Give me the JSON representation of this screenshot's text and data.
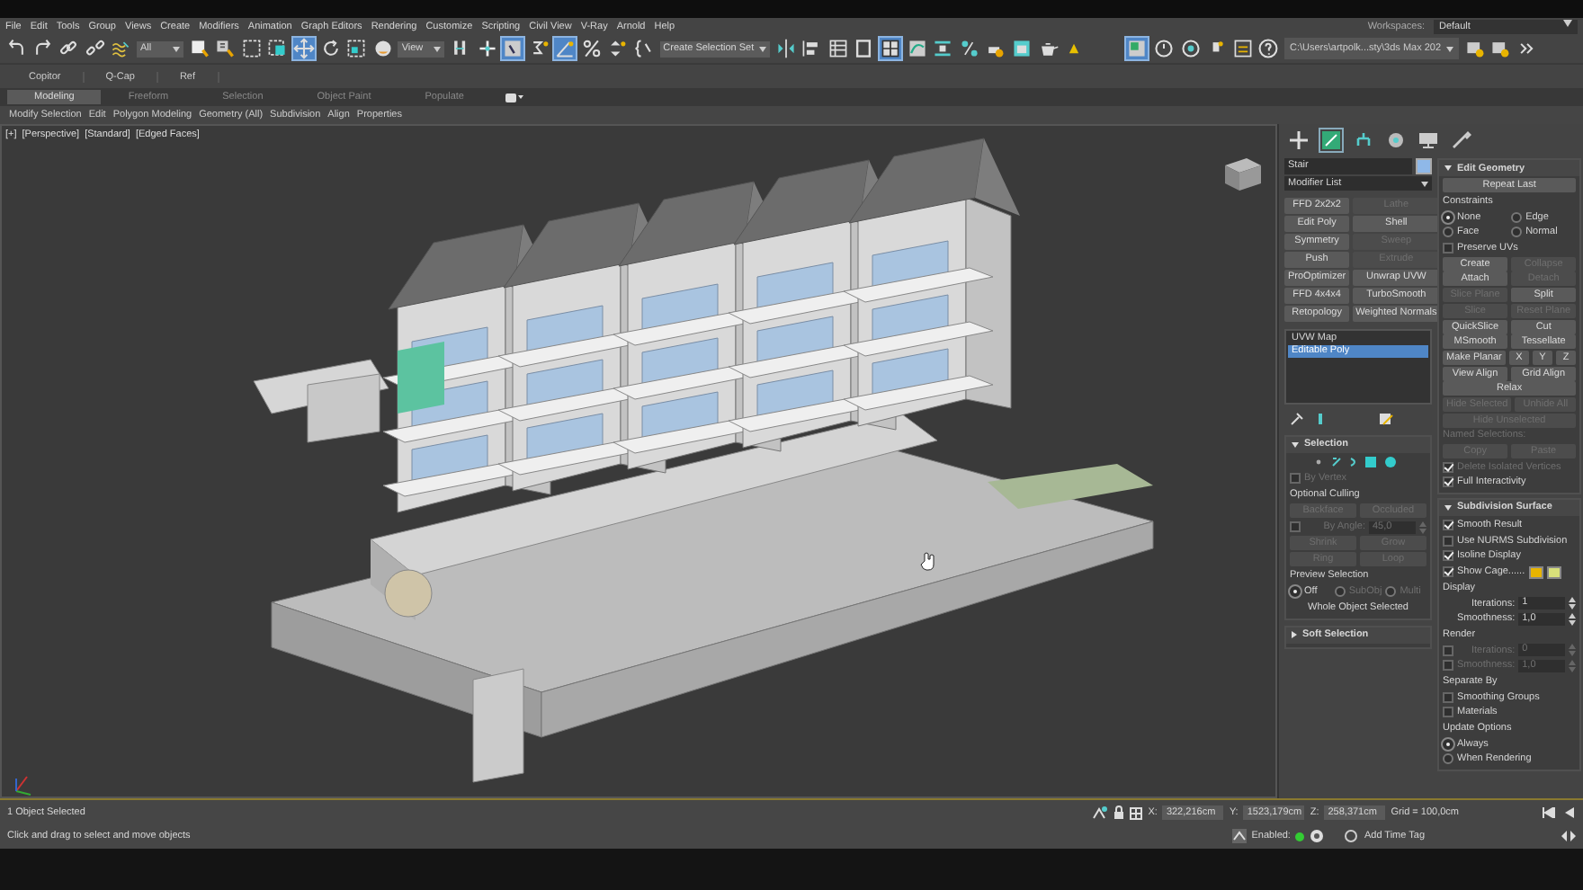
{
  "menu_bar": {
    "items": [
      "File",
      "Edit",
      "Tools",
      "Group",
      "Views",
      "Create",
      "Modifiers",
      "Animation",
      "Graph Editors",
      "Rendering",
      "Customize",
      "Scripting",
      "Civil View",
      "V-Ray",
      "Arnold",
      "Help"
    ],
    "workspaces_label": "Workspaces:",
    "workspace": "Default"
  },
  "toolbar": {
    "tools": [
      {
        "kind": "undo",
        "active": false
      },
      {
        "kind": "redo",
        "active": false
      },
      {
        "kind": "link",
        "active": false
      },
      {
        "kind": "unlink",
        "active": false
      },
      {
        "kind": "bind",
        "active": false
      },
      {
        "kind": "dropdown",
        "label": "All",
        "active": false
      },
      {
        "kind": "select",
        "active": false
      },
      {
        "kind": "select_name",
        "active": false
      },
      {
        "kind": "region",
        "active": false
      },
      {
        "kind": "crossing",
        "active": false
      },
      {
        "kind": "move",
        "active": true
      },
      {
        "kind": "rotate",
        "active": false
      },
      {
        "kind": "scale",
        "active": false
      },
      {
        "kind": "place",
        "active": false
      },
      {
        "kind": "dropdown",
        "label": "View",
        "active": false
      },
      {
        "kind": "pivot",
        "active": false
      },
      {
        "kind": "manipulate",
        "active": false
      },
      {
        "kind": "keyboard",
        "active": true
      },
      {
        "kind": "snap",
        "active": false
      },
      {
        "kind": "angle_snap",
        "active": true
      },
      {
        "kind": "percent_snap",
        "active": false
      },
      {
        "kind": "spinner_snap",
        "active": false
      },
      {
        "kind": "named_sel",
        "active": false
      },
      {
        "kind": "dropdown",
        "label": "Create Selection Set",
        "active": false
      },
      {
        "kind": "mirror",
        "active": false
      },
      {
        "kind": "align",
        "active": false
      },
      {
        "kind": "layer",
        "active": false
      },
      {
        "kind": "panel",
        "active": false
      },
      {
        "kind": "ribbon",
        "active": true
      },
      {
        "kind": "curve",
        "active": false
      },
      {
        "kind": "schematic",
        "active": false
      },
      {
        "kind": "material",
        "active": false
      },
      {
        "kind": "render_setup",
        "active": false
      },
      {
        "kind": "render_frame",
        "active": false
      },
      {
        "kind": "render",
        "active": false
      },
      {
        "kind": "warning",
        "active": false
      },
      {
        "kind": "gap"
      },
      {
        "kind": "layout",
        "active": true
      },
      {
        "kind": "clock",
        "active": false
      },
      {
        "kind": "dial",
        "active": false
      },
      {
        "kind": "bulb",
        "active": false
      },
      {
        "kind": "window",
        "active": false
      },
      {
        "kind": "help",
        "active": false
      },
      {
        "kind": "path",
        "label": "C:\\Users\\artpolk...sty\\3ds Max 202",
        "active": false
      },
      {
        "kind": "project",
        "active": false
      },
      {
        "kind": "project",
        "active": false
      },
      {
        "kind": "more",
        "active": false
      }
    ]
  },
  "ribbon": {
    "quick": [
      "Copitor",
      "Q-Cap",
      "Ref"
    ],
    "tabs": [
      {
        "label": "Modeling",
        "selected": true
      },
      {
        "label": "Freeform",
        "selected": false
      },
      {
        "label": "Selection",
        "selected": false
      },
      {
        "label": "Object Paint",
        "selected": false
      },
      {
        "label": "Populate",
        "selected": false
      }
    ],
    "panels": [
      "Modify Selection",
      "Edit",
      "Polygon Modeling",
      "Geometry (All)",
      "Subdivision",
      "Align",
      "Properties"
    ]
  },
  "viewport": {
    "labels": [
      "[+]",
      "[Perspective]",
      "[Standard]",
      "[Edged Faces]"
    ]
  },
  "command_panel": {
    "tabs": [
      {
        "kind": "create",
        "selected": false
      },
      {
        "kind": "modify",
        "selected": true
      },
      {
        "kind": "hierarchy",
        "selected": false
      },
      {
        "kind": "motion",
        "selected": false
      },
      {
        "kind": "display",
        "selected": false
      },
      {
        "kind": "utilities",
        "selected": false
      }
    ],
    "object_name": "Stair",
    "modifier_list": "Modifier List",
    "modifier_buttons": [
      {
        "label": "FFD 2x2x2",
        "disabled": false
      },
      {
        "label": "Lathe",
        "disabled": true
      },
      {
        "label": "Edit Poly",
        "disabled": false
      },
      {
        "label": "Shell",
        "disabled": false
      },
      {
        "label": "Symmetry",
        "disabled": false
      },
      {
        "label": "Sweep",
        "disabled": true
      },
      {
        "label": "Push",
        "disabled": false
      },
      {
        "label": "Extrude",
        "disabled": true
      },
      {
        "label": "ProOptimizer",
        "disabled": false
      },
      {
        "label": "Unwrap UVW",
        "disabled": false
      },
      {
        "label": "FFD 4x4x4",
        "disabled": false
      },
      {
        "label": "TurboSmooth",
        "disabled": false
      },
      {
        "label": "Retopology",
        "disabled": false
      },
      {
        "label": "Weighted Normals",
        "disabled": false
      }
    ],
    "stack": [
      {
        "label": "UVW Map",
        "selected": false
      },
      {
        "label": "Editable Poly",
        "selected": true
      }
    ],
    "left_rollouts": [
      {
        "title": "Selection",
        "expanded": true,
        "rows": [
          [
            {
              "kind": "icons"
            }
          ],
          [
            {
              "kind": "checkbox",
              "label": "By Vertex",
              "checked": false,
              "disabled": true
            }
          ],
          [
            {
              "kind": "label",
              "label": "Optional Culling",
              "disabled": false
            }
          ],
          [
            {
              "kind": "button",
              "label": "Backface",
              "disabled": true
            },
            {
              "kind": "button",
              "label": "Occluded",
              "disabled": true
            }
          ],
          [
            {
              "kind": "check_spinner",
              "label": "By Angle:",
              "value": "45,0",
              "checked": false,
              "disabled": true
            }
          ],
          [
            {
              "kind": "button",
              "label": "Shrink",
              "disabled": true
            },
            {
              "kind": "button",
              "label": "Grow",
              "disabled": true
            }
          ],
          [
            {
              "kind": "button",
              "label": "Ring",
              "disabled": true
            },
            {
              "kind": "button",
              "label": "Loop",
              "disabled": true
            }
          ],
          [
            {
              "kind": "label",
              "label": "Preview Selection",
              "disabled": false
            }
          ],
          [
            {
              "kind": "radio",
              "label": "Off",
              "selected": true,
              "disabled": false
            },
            {
              "kind": "radio",
              "label": "SubObj",
              "selected": false,
              "disabled": true
            },
            {
              "kind": "radio",
              "label": "Multi",
              "selected": false,
              "disabled": true
            }
          ],
          [
            {
              "kind": "note",
              "label": "Whole Object Selected",
              "disabled": false
            }
          ]
        ]
      },
      {
        "title": "Soft Selection",
        "expanded": false
      }
    ],
    "right_rollouts": [
      {
        "title": "Edit Geometry",
        "expanded": true,
        "rows": [
          [
            {
              "kind": "button",
              "label": "Repeat Last",
              "disabled": false
            }
          ],
          [
            {
              "kind": "label",
              "label": "Constraints",
              "disabled": false
            }
          ],
          [
            {
              "kind": "radio",
              "label": "None",
              "selected": true,
              "disabled": false
            },
            {
              "kind": "radio",
              "label": "Edge",
              "selected": false,
              "disabled": false
            }
          ],
          [
            {
              "kind": "radio",
              "label": "Face",
              "selected": false,
              "disabled": false
            },
            {
              "kind": "radio",
              "label": "Normal",
              "selected": false,
              "disabled": false
            }
          ],
          [
            {
              "kind": "checkbox",
              "label": "Preserve UVs",
              "checked": false,
              "disabled": false
            }
          ],
          [
            {
              "kind": "button",
              "label": "Create",
              "disabled": false
            },
            {
              "kind": "button",
              "label": "Collapse",
              "disabled": true
            }
          ],
          [
            {
              "kind": "button",
              "label": "Attach",
              "disabled": false
            },
            {
              "kind": "button",
              "label": "Detach",
              "disabled": true
            }
          ],
          [
            {
              "kind": "button",
              "label": "Slice Plane",
              "disabled": true
            },
            {
              "kind": "button",
              "label": "Split",
              "disabled": false
            }
          ],
          [
            {
              "kind": "button",
              "label": "Slice",
              "disabled": true
            },
            {
              "kind": "button",
              "label": "Reset Plane",
              "disabled": true
            }
          ],
          [
            {
              "kind": "button",
              "label": "QuickSlice",
              "disabled": false
            },
            {
              "kind": "button",
              "label": "Cut",
              "disabled": false
            }
          ],
          [
            {
              "kind": "button",
              "label": "MSmooth",
              "disabled": false
            },
            {
              "kind": "button",
              "label": "Tessellate",
              "disabled": false
            }
          ],
          [
            {
              "kind": "button",
              "label": "Make Planar",
              "disabled": false
            },
            {
              "kind": "button",
              "label": "X",
              "disabled": false
            },
            {
              "kind": "button",
              "label": "Y",
              "disabled": false
            },
            {
              "kind": "button",
              "label": "Z",
              "disabled": false
            }
          ],
          [
            {
              "kind": "button",
              "label": "View Align",
              "disabled": false
            },
            {
              "kind": "button",
              "label": "Grid Align",
              "disabled": false
            }
          ],
          [
            {
              "kind": "button",
              "label": "Relax",
              "disabled": false
            }
          ],
          [
            {
              "kind": "button",
              "label": "Hide Selected",
              "disabled": true
            },
            {
              "kind": "button",
              "label": "Unhide All",
              "disabled": true
            }
          ],
          [
            {
              "kind": "button",
              "label": "Hide Unselected",
              "disabled": true
            }
          ],
          [
            {
              "kind": "label",
              "label": "Named Selections:",
              "disabled": true
            }
          ],
          [
            {
              "kind": "button",
              "label": "Copy",
              "disabled": true
            },
            {
              "kind": "button",
              "label": "Paste",
              "disabled": true
            }
          ],
          [
            {
              "kind": "checkbox",
              "label": "Delete Isolated Vertices",
              "checked": true,
              "disabled": true
            }
          ],
          [
            {
              "kind": "checkbox",
              "label": "Full Interactivity",
              "checked": true,
              "disabled": false
            }
          ]
        ]
      },
      {
        "title": "Subdivision Surface",
        "expanded": true,
        "rows": [
          [
            {
              "kind": "checkbox",
              "label": "Smooth Result",
              "checked": true,
              "disabled": false
            }
          ],
          [
            {
              "kind": "checkbox",
              "label": "Use NURMS Subdivision",
              "checked": false,
              "disabled": false
            }
          ],
          [
            {
              "kind": "checkbox",
              "label": "Isoline Display",
              "checked": true,
              "disabled": false
            }
          ],
          [
            {
              "kind": "checkbox",
              "label": "Show Cage......",
              "checked": true,
              "disabled": false
            },
            {
              "kind": "swatch",
              "color": "#e8b400"
            },
            {
              "kind": "swatch",
              "color": "#d8e07a"
            }
          ],
          [
            {
              "kind": "label",
              "label": "Display",
              "disabled": false
            }
          ],
          [
            {
              "kind": "spinner",
              "label": "Iterations:",
              "value": "1",
              "disabled": false
            }
          ],
          [
            {
              "kind": "spinner",
              "label": "Smoothness:",
              "value": "1,0",
              "disabled": false
            }
          ],
          [
            {
              "kind": "label",
              "label": "Render",
              "disabled": false
            }
          ],
          [
            {
              "kind": "check_spinner",
              "label": "Iterations:",
              "value": "0",
              "checked": false,
              "disabled": true
            }
          ],
          [
            {
              "kind": "check_spinner",
              "label": "Smoothness:",
              "value": "1,0",
              "checked": false,
              "disabled": true
            }
          ],
          [
            {
              "kind": "label",
              "label": "Separate By",
              "disabled": false
            }
          ],
          [
            {
              "kind": "checkbox",
              "label": "Smoothing Groups",
              "checked": false,
              "disabled": false
            }
          ],
          [
            {
              "kind": "checkbox",
              "label": "Materials",
              "checked": false,
              "disabled": false
            }
          ],
          [
            {
              "kind": "label",
              "label": "Update Options",
              "disabled": false
            }
          ],
          [
            {
              "kind": "radio",
              "label": "Always",
              "selected": true,
              "disabled": false
            }
          ],
          [
            {
              "kind": "radio",
              "label": "When Rendering",
              "selected": false,
              "disabled": false
            }
          ]
        ]
      }
    ]
  },
  "status_bar": {
    "selection": "1 Object Selected",
    "prompt": "Click and drag to select and move objects",
    "coordinates": [
      {
        "axis": "X:",
        "value": "322,216cm"
      },
      {
        "axis": "Y:",
        "value": "1523,179cm"
      },
      {
        "axis": "Z:",
        "value": "258,371cm"
      }
    ],
    "grid": "Grid = 100,0cm",
    "enabled_label": "Enabled:",
    "time_tag": "Add Time Tag"
  }
}
